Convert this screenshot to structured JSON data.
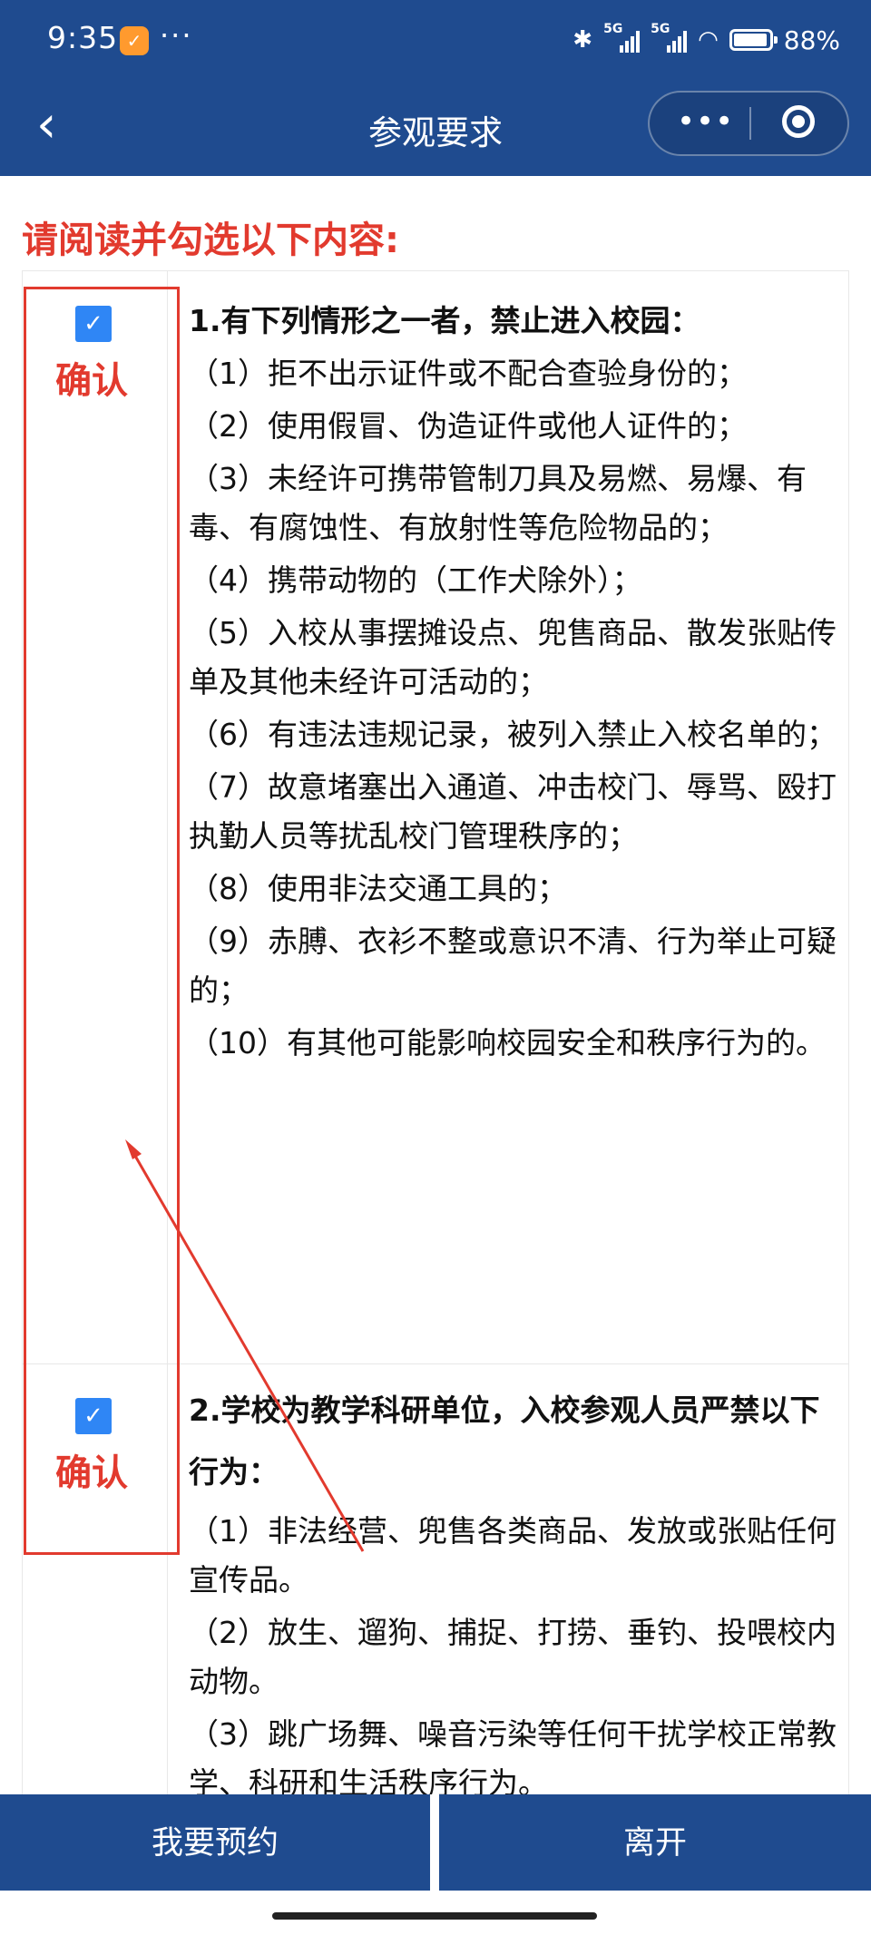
{
  "status_bar": {
    "time": "9:35",
    "battery": "88%"
  },
  "nav": {
    "title": "参观要求"
  },
  "instruction": "请阅读并勾选以下内容:",
  "sections": [
    {
      "confirm_label": "确认",
      "checked": true,
      "title": "1.有下列情形之一者，禁止进入校园：",
      "items": [
        "（1）拒不出示证件或不配合查验身份的；",
        "（2）使用假冒、伪造证件或他人证件的；",
        "（3）未经许可携带管制刀具及易燃、易爆、有毒、有腐蚀性、有放射性等危险物品的；",
        "（4）携带动物的（工作犬除外）；",
        "（5）入校从事摆摊设点、兜售商品、散发张贴传单及其他未经许可活动的；",
        "（6）有违法违规记录，被列入禁止入校名单的；",
        "（7）故意堵塞出入通道、冲击校门、辱骂、殴打执勤人员等扰乱校门管理秩序的；",
        "（8）使用非法交通工具的；",
        "（9）赤膊、衣衫不整或意识不清、行为举止可疑的；",
        "（10）有其他可能影响校园安全和秩序行为的。"
      ]
    },
    {
      "confirm_label": "确认",
      "checked": true,
      "title": "2.学校为教学科研单位，入校参观人员严禁以下行为：",
      "items": [
        "（1）非法经营、兜售各类商品、发放或张贴任何宣传品。",
        "（2）放生、遛狗、捕捉、打捞、垂钓、投喂校内动物。",
        "（3）跳广场舞、噪音污染等任何干扰学校正常教学、科研和生活秩序行为。"
      ]
    }
  ],
  "buttons": {
    "reserve": "我要预约",
    "leave": "离开"
  },
  "colors": {
    "header": "#1f4b8f",
    "accent_red": "#e23a2e",
    "checkbox": "#2f86f5"
  }
}
